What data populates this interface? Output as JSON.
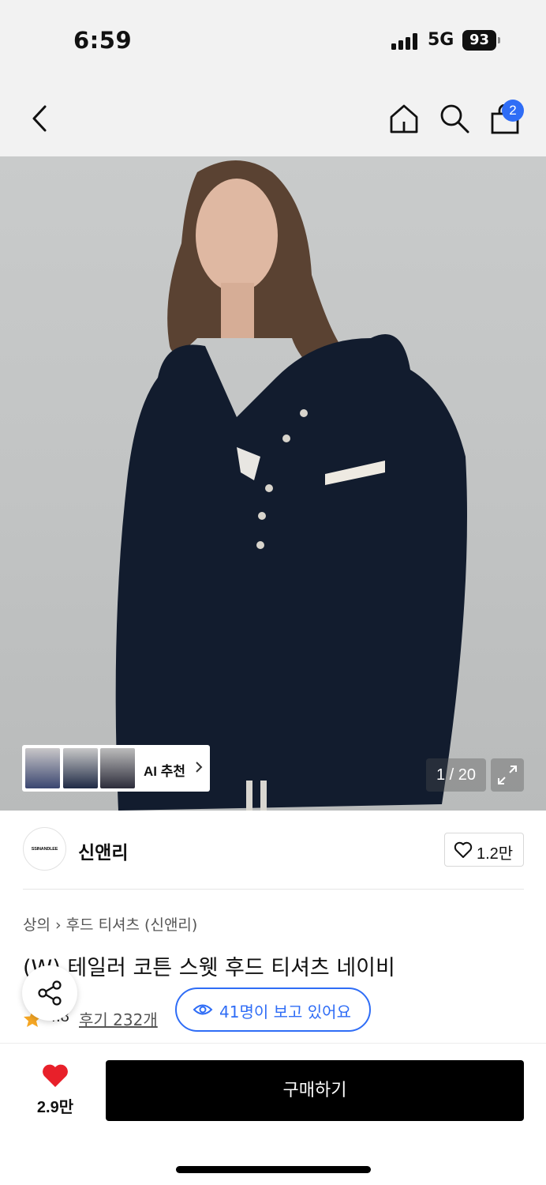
{
  "status_bar": {
    "time": "6:59",
    "network": "5G",
    "battery": "93"
  },
  "nav": {
    "icons": [
      "back-icon",
      "home-icon",
      "search-icon",
      "shopping-bag-icon"
    ],
    "cart_count": "2"
  },
  "gallery": {
    "ai_recommend_label": "AI 추천",
    "counter": "1 / 20",
    "current_index": 1,
    "total": 20
  },
  "brand": {
    "logo_text": "SSINANDLEE",
    "name": "신앤리",
    "likes": "1.2만"
  },
  "product": {
    "breadcrumb": [
      "상의",
      "후드 티셔츠 (신앤리)"
    ],
    "title": "(W) 테일러 코튼 스웻 후드 티셔츠 네이비",
    "rating": "4.8",
    "reviews": "후기 232개",
    "viewing_now": "41명이 보고 있어요"
  },
  "bottom_bar": {
    "favorite_count": "2.9만",
    "buy_label": "구매하기"
  },
  "colors": {
    "accent_blue": "#2f6df6",
    "heart_red": "#e8202a",
    "star_orange": "#f5a623",
    "buy_button": "#000000"
  }
}
